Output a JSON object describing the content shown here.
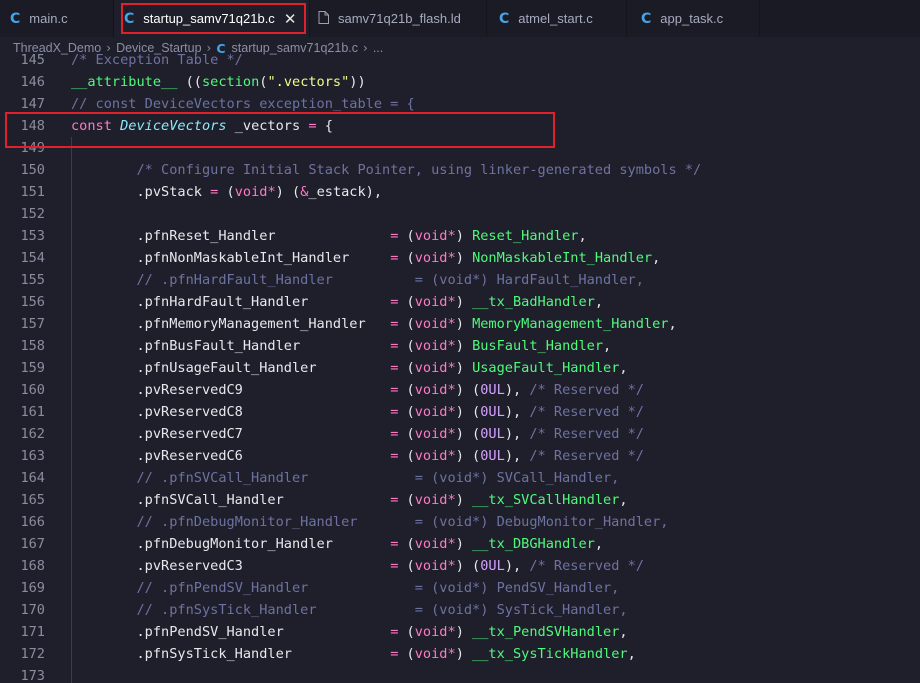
{
  "tabs": [
    {
      "icon": "C",
      "label": "main.c",
      "active": false,
      "closable": false
    },
    {
      "icon": "C",
      "label": "startup_samv71q21b.c",
      "active": true,
      "closable": true
    },
    {
      "icon": "file",
      "label": "samv71q21b_flash.ld",
      "active": false,
      "closable": false
    },
    {
      "icon": "C",
      "label": "atmel_start.c",
      "active": false,
      "closable": false
    },
    {
      "icon": "C",
      "label": "app_task.c",
      "active": false,
      "closable": false
    }
  ],
  "breadcrumb": {
    "items": [
      "ThreadX_Demo",
      "Device_Startup",
      "startup_samv71q21b.c",
      "..."
    ]
  },
  "colors": {
    "keyword": "#ff79c6",
    "type": "#8be9fd",
    "function": "#50fa7b",
    "string": "#f1fa8c",
    "comment": "#6e72a0",
    "number": "#d4a2ff",
    "highlight": "#e0202a"
  },
  "lines": [
    {
      "n": "145",
      "tokens": [
        [
          "cm",
          "/* Exception Table */"
        ]
      ]
    },
    {
      "n": "146",
      "tokens": [
        [
          "fn",
          "__attribute__"
        ],
        [
          "plain",
          " (("
        ],
        [
          "fn",
          "section"
        ],
        [
          "plain",
          "("
        ],
        [
          "str",
          "\".vectors\""
        ],
        [
          "plain",
          "))"
        ]
      ]
    },
    {
      "n": "147",
      "tokens": [
        [
          "cm",
          "// const DeviceVectors exception_table = {"
        ]
      ]
    },
    {
      "n": "148",
      "tokens": [
        [
          "kw",
          "const"
        ],
        [
          "plain",
          " "
        ],
        [
          "type",
          "DeviceVectors"
        ],
        [
          "plain",
          " _vectors "
        ],
        [
          "op",
          "="
        ],
        [
          "plain",
          " {"
        ]
      ]
    },
    {
      "n": "149",
      "tokens": []
    },
    {
      "n": "150",
      "tokens": [
        [
          "plain",
          "        "
        ],
        [
          "cm",
          "/* Configure Initial Stack Pointer, using linker-generated symbols */"
        ]
      ]
    },
    {
      "n": "151",
      "tokens": [
        [
          "plain",
          "        .pvStack "
        ],
        [
          "op",
          "="
        ],
        [
          "plain",
          " ("
        ],
        [
          "kw",
          "void"
        ],
        [
          "op",
          "*"
        ],
        [
          "plain",
          ") ("
        ],
        [
          "op",
          "&"
        ],
        [
          "plain",
          "_estack),"
        ]
      ]
    },
    {
      "n": "152",
      "tokens": []
    },
    {
      "n": "153",
      "tokens": [
        [
          "plain",
          "        .pfnReset_Handler              "
        ],
        [
          "op",
          "="
        ],
        [
          "plain",
          " ("
        ],
        [
          "kw",
          "void"
        ],
        [
          "op",
          "*"
        ],
        [
          "plain",
          ") "
        ],
        [
          "fn",
          "Reset_Handler"
        ],
        [
          "plain",
          ","
        ]
      ]
    },
    {
      "n": "154",
      "tokens": [
        [
          "plain",
          "        .pfnNonMaskableInt_Handler     "
        ],
        [
          "op",
          "="
        ],
        [
          "plain",
          " ("
        ],
        [
          "kw",
          "void"
        ],
        [
          "op",
          "*"
        ],
        [
          "plain",
          ") "
        ],
        [
          "fn",
          "NonMaskableInt_Handler"
        ],
        [
          "plain",
          ","
        ]
      ]
    },
    {
      "n": "155",
      "tokens": [
        [
          "plain",
          "        "
        ],
        [
          "cm",
          "// .pfnHardFault_Handler          = (void*) HardFault_Handler,"
        ]
      ]
    },
    {
      "n": "156",
      "tokens": [
        [
          "plain",
          "        .pfnHardFault_Handler          "
        ],
        [
          "op",
          "="
        ],
        [
          "plain",
          " ("
        ],
        [
          "kw",
          "void"
        ],
        [
          "op",
          "*"
        ],
        [
          "plain",
          ") "
        ],
        [
          "fn",
          "__tx_BadHandler"
        ],
        [
          "plain",
          ","
        ]
      ]
    },
    {
      "n": "157",
      "tokens": [
        [
          "plain",
          "        .pfnMemoryManagement_Handler   "
        ],
        [
          "op",
          "="
        ],
        [
          "plain",
          " ("
        ],
        [
          "kw",
          "void"
        ],
        [
          "op",
          "*"
        ],
        [
          "plain",
          ") "
        ],
        [
          "fn",
          "MemoryManagement_Handler"
        ],
        [
          "plain",
          ","
        ]
      ]
    },
    {
      "n": "158",
      "tokens": [
        [
          "plain",
          "        .pfnBusFault_Handler           "
        ],
        [
          "op",
          "="
        ],
        [
          "plain",
          " ("
        ],
        [
          "kw",
          "void"
        ],
        [
          "op",
          "*"
        ],
        [
          "plain",
          ") "
        ],
        [
          "fn",
          "BusFault_Handler"
        ],
        [
          "plain",
          ","
        ]
      ]
    },
    {
      "n": "159",
      "tokens": [
        [
          "plain",
          "        .pfnUsageFault_Handler         "
        ],
        [
          "op",
          "="
        ],
        [
          "plain",
          " ("
        ],
        [
          "kw",
          "void"
        ],
        [
          "op",
          "*"
        ],
        [
          "plain",
          ") "
        ],
        [
          "fn",
          "UsageFault_Handler"
        ],
        [
          "plain",
          ","
        ]
      ]
    },
    {
      "n": "160",
      "tokens": [
        [
          "plain",
          "        .pvReservedC9                  "
        ],
        [
          "op",
          "="
        ],
        [
          "plain",
          " ("
        ],
        [
          "kw",
          "void"
        ],
        [
          "op",
          "*"
        ],
        [
          "plain",
          ") ("
        ],
        [
          "num",
          "0UL"
        ],
        [
          "plain",
          "), "
        ],
        [
          "cm",
          "/* Reserved */"
        ]
      ]
    },
    {
      "n": "161",
      "tokens": [
        [
          "plain",
          "        .pvReservedC8                  "
        ],
        [
          "op",
          "="
        ],
        [
          "plain",
          " ("
        ],
        [
          "kw",
          "void"
        ],
        [
          "op",
          "*"
        ],
        [
          "plain",
          ") ("
        ],
        [
          "num",
          "0UL"
        ],
        [
          "plain",
          "), "
        ],
        [
          "cm",
          "/* Reserved */"
        ]
      ]
    },
    {
      "n": "162",
      "tokens": [
        [
          "plain",
          "        .pvReservedC7                  "
        ],
        [
          "op",
          "="
        ],
        [
          "plain",
          " ("
        ],
        [
          "kw",
          "void"
        ],
        [
          "op",
          "*"
        ],
        [
          "plain",
          ") ("
        ],
        [
          "num",
          "0UL"
        ],
        [
          "plain",
          "), "
        ],
        [
          "cm",
          "/* Reserved */"
        ]
      ]
    },
    {
      "n": "163",
      "tokens": [
        [
          "plain",
          "        .pvReservedC6                  "
        ],
        [
          "op",
          "="
        ],
        [
          "plain",
          " ("
        ],
        [
          "kw",
          "void"
        ],
        [
          "op",
          "*"
        ],
        [
          "plain",
          ") ("
        ],
        [
          "num",
          "0UL"
        ],
        [
          "plain",
          "), "
        ],
        [
          "cm",
          "/* Reserved */"
        ]
      ]
    },
    {
      "n": "164",
      "tokens": [
        [
          "plain",
          "        "
        ],
        [
          "cm",
          "// .pfnSVCall_Handler             = (void*) SVCall_Handler,"
        ]
      ]
    },
    {
      "n": "165",
      "tokens": [
        [
          "plain",
          "        .pfnSVCall_Handler             "
        ],
        [
          "op",
          "="
        ],
        [
          "plain",
          " ("
        ],
        [
          "kw",
          "void"
        ],
        [
          "op",
          "*"
        ],
        [
          "plain",
          ") "
        ],
        [
          "fn",
          "__tx_SVCallHandler"
        ],
        [
          "plain",
          ","
        ]
      ]
    },
    {
      "n": "166",
      "tokens": [
        [
          "plain",
          "        "
        ],
        [
          "cm",
          "// .pfnDebugMonitor_Handler       = (void*) DebugMonitor_Handler,"
        ]
      ]
    },
    {
      "n": "167",
      "tokens": [
        [
          "plain",
          "        .pfnDebugMonitor_Handler       "
        ],
        [
          "op",
          "="
        ],
        [
          "plain",
          " ("
        ],
        [
          "kw",
          "void"
        ],
        [
          "op",
          "*"
        ],
        [
          "plain",
          ") "
        ],
        [
          "fn",
          "__tx_DBGHandler"
        ],
        [
          "plain",
          ","
        ]
      ]
    },
    {
      "n": "168",
      "tokens": [
        [
          "plain",
          "        .pvReservedC3                  "
        ],
        [
          "op",
          "="
        ],
        [
          "plain",
          " ("
        ],
        [
          "kw",
          "void"
        ],
        [
          "op",
          "*"
        ],
        [
          "plain",
          ") ("
        ],
        [
          "num",
          "0UL"
        ],
        [
          "plain",
          "), "
        ],
        [
          "cm",
          "/* Reserved */"
        ]
      ]
    },
    {
      "n": "169",
      "tokens": [
        [
          "plain",
          "        "
        ],
        [
          "cm",
          "// .pfnPendSV_Handler             = (void*) PendSV_Handler,"
        ]
      ]
    },
    {
      "n": "170",
      "tokens": [
        [
          "plain",
          "        "
        ],
        [
          "cm",
          "// .pfnSysTick_Handler            = (void*) SysTick_Handler,"
        ]
      ]
    },
    {
      "n": "171",
      "tokens": [
        [
          "plain",
          "        .pfnPendSV_Handler             "
        ],
        [
          "op",
          "="
        ],
        [
          "plain",
          " ("
        ],
        [
          "kw",
          "void"
        ],
        [
          "op",
          "*"
        ],
        [
          "plain",
          ") "
        ],
        [
          "fn",
          "__tx_PendSVHandler"
        ],
        [
          "plain",
          ","
        ]
      ]
    },
    {
      "n": "172",
      "tokens": [
        [
          "plain",
          "        .pfnSysTick_Handler            "
        ],
        [
          "op",
          "="
        ],
        [
          "plain",
          " ("
        ],
        [
          "kw",
          "void"
        ],
        [
          "op",
          "*"
        ],
        [
          "plain",
          ") "
        ],
        [
          "fn",
          "__tx_SysTickHandler"
        ],
        [
          "plain",
          ","
        ]
      ]
    },
    {
      "n": "173",
      "tokens": []
    }
  ]
}
